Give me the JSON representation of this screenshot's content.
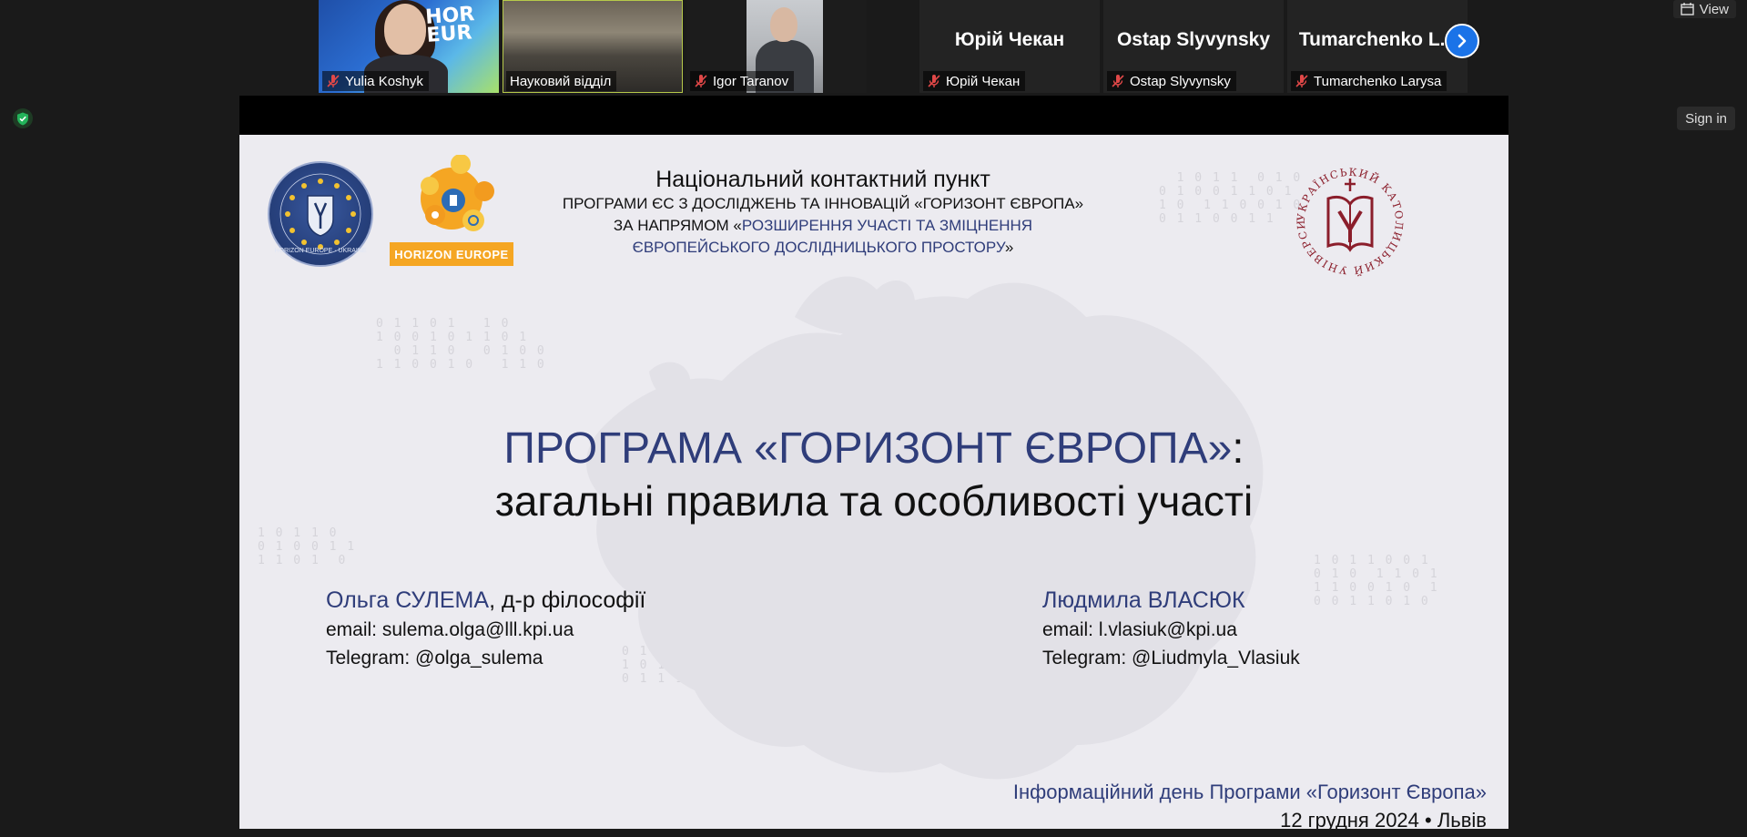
{
  "toolbar": {
    "view_label": "View",
    "sign_in_label": "Sign in"
  },
  "participants": [
    {
      "name": "Yulia Koshyk",
      "muted": true,
      "video": true,
      "bg_text": "HORIZON EUROPE"
    },
    {
      "name": "Науковий відділ",
      "muted": false,
      "video": true,
      "active_speaker": true
    },
    {
      "name": "Igor Taranov",
      "muted": true,
      "video": true
    },
    {
      "name": "Юрій Чекан",
      "display_name": "Юрій Чекан",
      "muted": true,
      "video": false
    },
    {
      "name": "Ostap Slyvynsky",
      "display_name": "Ostap Slyvynsky",
      "muted": true,
      "video": false
    },
    {
      "name": "Tumarchenko Larysa",
      "display_name": "Tumarchenko  L...",
      "muted": true,
      "video": false
    }
  ],
  "slide": {
    "logo_he_text": "HORIZON EUROPE",
    "logo_ua_ring": "HORIZON EUROPE · UKRAINE",
    "header_line1": "Національний контактний пункт",
    "header_line2": "ПРОГРАМИ ЄС З ДОСЛІДЖЕНЬ ТА ІННОВАЦІЙ «ГОРИЗОНТ ЄВРОПА»",
    "header_line3_prefix": "ЗА НАПРЯМОМ «",
    "header_line3_accent": "РОЗШИРЕННЯ УЧАСТІ ТА ЗМІЦНЕННЯ",
    "header_line4_accent": "ЄВРОПЕЙСЬКОГО ДОСЛІДНИЦЬКОГО ПРОСТОРУ",
    "header_line4_suffix": "»",
    "ucu_ring": "УКРАЇНСЬКИЙ КАТОЛИЦЬКИЙ УНІВЕРСИТЕТ",
    "title_line1": "ПРОГРАМА «ГОРИЗОНТ ЄВРОПА»",
    "title_colon": ":",
    "title_line2": "загальні правила та особливості участі",
    "speaker1": {
      "name": "Ольга СУЛЕМА",
      "degree": ", д-р філософії",
      "email": "email: sulema.olga@lll.kpi.ua",
      "telegram": "Telegram: @olga_sulema"
    },
    "speaker2": {
      "name": "Людмила ВЛАСЮК",
      "email": "email: l.vlasiuk@kpi.ua",
      "telegram": "Telegram: @Liudmyla_Vlasiuk"
    },
    "footer_line1": "Інформаційний день Програми «Горизонт Європа»",
    "footer_line2": "12 грудня 2024 • Львів"
  },
  "colors": {
    "accent_blue": "#2f3d7a",
    "he_orange": "#f5a623",
    "ucu_red": "#8b1e2b",
    "next_button": "#1a73e8"
  }
}
